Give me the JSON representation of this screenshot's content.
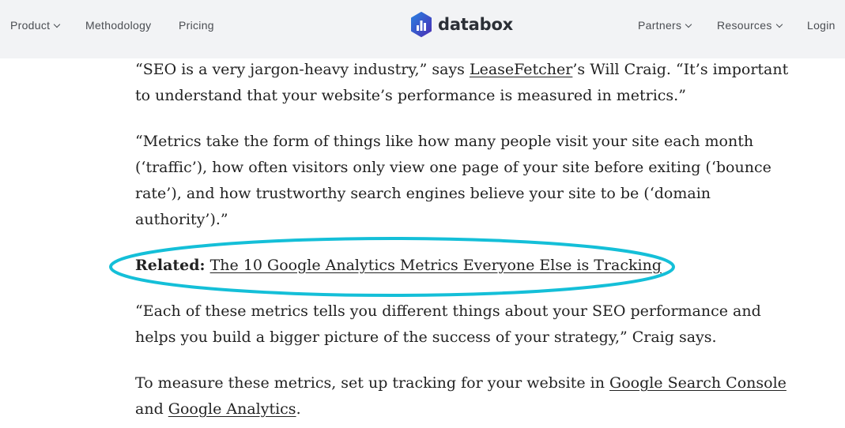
{
  "header": {
    "nav_left": [
      {
        "label": "Product",
        "has_dropdown": true
      },
      {
        "label": "Methodology",
        "has_dropdown": false
      },
      {
        "label": "Pricing",
        "has_dropdown": false
      }
    ],
    "logo": {
      "text": "databox",
      "icon": "databox-hexagon-bar-chart-icon"
    },
    "nav_right": [
      {
        "label": "Partners",
        "has_dropdown": true
      },
      {
        "label": "Resources",
        "has_dropdown": true
      },
      {
        "label": "Login",
        "has_dropdown": false
      }
    ]
  },
  "article": {
    "p1": {
      "before": "“SEO is a very jargon-heavy industry,” says ",
      "link": "LeaseFetcher",
      "after": "’s Will Craig. “It’s important to understand that your website’s performance is measured in metrics.”"
    },
    "p2": {
      "text": "“Metrics take the form of things like how many people visit your site each month (‘traffic’), how often visitors only view one page of your site before exiting (‘bounce rate’), and how trustworthy search engines believe your site to be (‘domain authority’).”"
    },
    "related": {
      "label": "Related:",
      "link": "The 10 Google Analytics Metrics Everyone Else is Tracking",
      "highlight_color": "#14bfd8"
    },
    "p4": {
      "text": "“Each of these metrics tells you different things about your SEO performance and helps you build a bigger picture of the success of your strategy,” Craig says."
    },
    "p5": {
      "before": "To measure these metrics, set up tracking for your website in ",
      "link1": "Google Search Console",
      "middle": " and ",
      "link2": "Google Analytics",
      "after": "."
    }
  }
}
